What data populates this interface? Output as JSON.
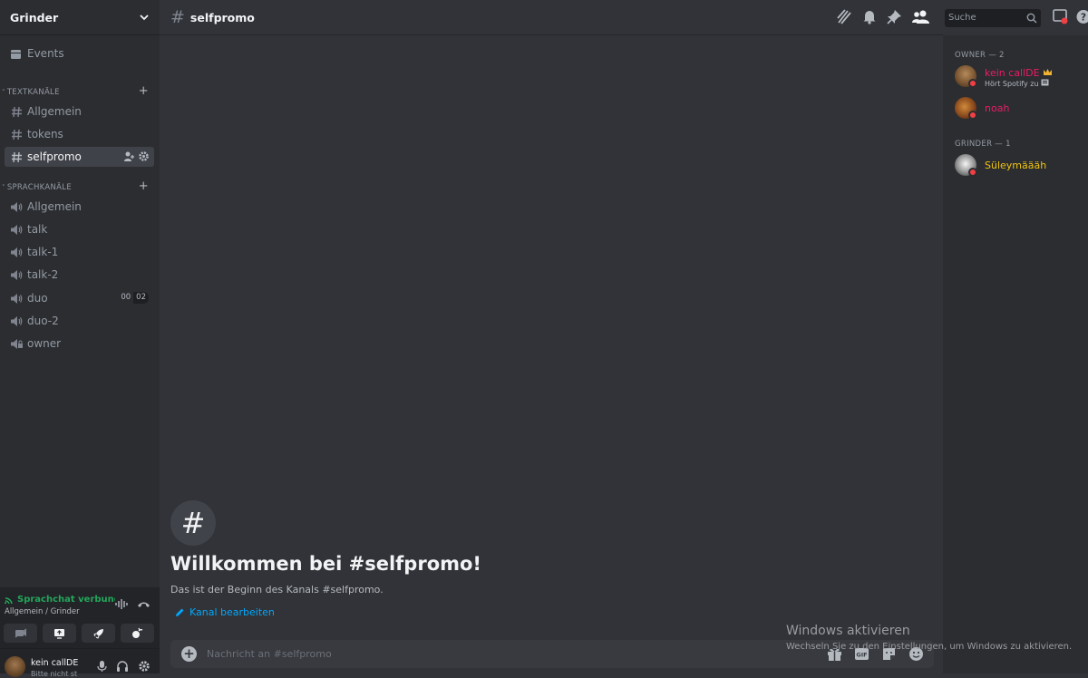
{
  "server": {
    "name": "Grinder"
  },
  "sidebar": {
    "events_label": "Events",
    "text_category": "TEXTKANÄLE",
    "text_channels": [
      {
        "name": "Allgemein"
      },
      {
        "name": "tokens"
      },
      {
        "name": "selfpromo",
        "active": true
      }
    ],
    "voice_category": "SPRACHKANÄLE",
    "voice_channels": [
      {
        "name": "Allgemein"
      },
      {
        "name": "talk"
      },
      {
        "name": "talk-1"
      },
      {
        "name": "talk-2"
      },
      {
        "name": "duo",
        "badge_a": "00",
        "badge_b": "02"
      },
      {
        "name": "duo-2"
      },
      {
        "name": "owner",
        "locked": true
      }
    ]
  },
  "voice_panel": {
    "status": "Sprachchat verbunden",
    "location": "Allgemein / Grinder"
  },
  "user_panel": {
    "name": "kein callDE",
    "status": "Bitte nicht st"
  },
  "channel": {
    "name": "selfpromo",
    "search_placeholder": "Suche",
    "welcome_title": "Willkommen bei #selfpromo!",
    "welcome_subtitle": "Das ist der Beginn des Kanals #selfpromo.",
    "edit_link": "Kanal bearbeiten",
    "composer_placeholder": "Nachricht an #selfpromo"
  },
  "members": {
    "groups": [
      {
        "label": "OWNER — 2",
        "members": [
          {
            "name": "kein callDE",
            "activity": "Hört Spotify zu",
            "color": "#e91e63",
            "crown": true
          },
          {
            "name": "noah",
            "activity": "",
            "color": "#e91e63"
          }
        ]
      },
      {
        "label": "GRINDER — 1",
        "members": [
          {
            "name": "Süleymäääh",
            "activity": "",
            "color": "#f1c40f"
          }
        ]
      }
    ]
  },
  "watermark": {
    "title": "Windows aktivieren",
    "subtitle": "Wechseln Sie zu den Einstellungen, um Windows zu aktivieren."
  },
  "colors": {
    "accent_link": "#00a8fc",
    "voice_connected": "#23a55a",
    "dnd": "#f23f43"
  }
}
